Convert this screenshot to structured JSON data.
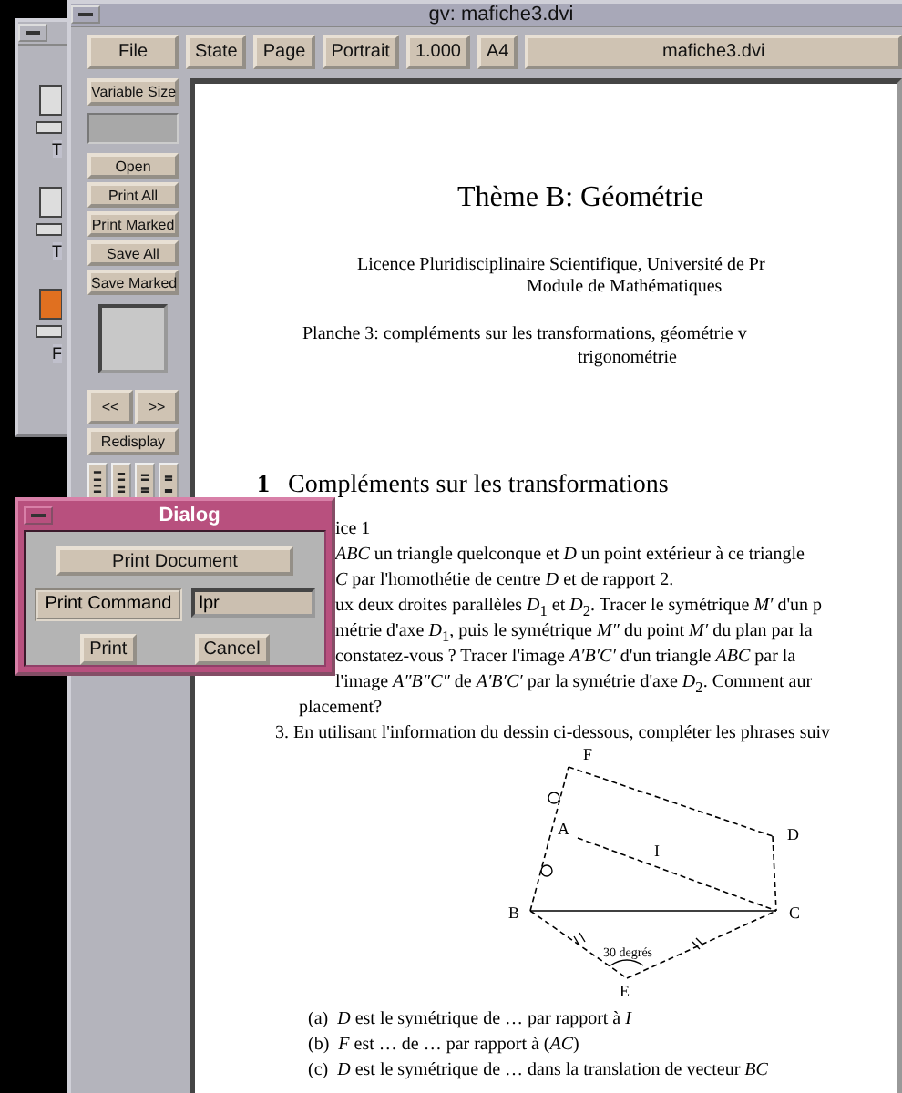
{
  "desktop_window": {
    "icon_labels": [
      "T",
      "T",
      "F"
    ]
  },
  "window": {
    "title": "gv: mafiche3.dvi"
  },
  "toolbar": {
    "buttons": [
      "File",
      "State",
      "Page",
      "Portrait",
      "1.000",
      "A4"
    ],
    "file_name": "mafiche3.dvi"
  },
  "sidebar": {
    "size_button": "Variable Size",
    "buttons": [
      "Open",
      "Print All",
      "Print Marked",
      "Save All",
      "Save Marked"
    ],
    "prev": "<<",
    "next": ">>",
    "redisplay": "Redisplay"
  },
  "document": {
    "lines": [
      {
        "kind": "title",
        "text": "Thème B: Géométrie"
      },
      {
        "kind": "text",
        "text": "Licence Pluridisciplinaire Scientifique, Université de Pr"
      },
      {
        "kind": "text",
        "text": "Module de Mathématiques"
      },
      {
        "kind": "text",
        "text": "Planche 3: compléments sur les transformations, géométrie v"
      },
      {
        "kind": "text",
        "text": "trigonométrie"
      },
      {
        "kind": "section",
        "number": "1",
        "text": "Compléments sur les transformations"
      },
      {
        "kind": "text",
        "text": "ice 1"
      },
      {
        "kind": "text",
        "text": "*ABC* un triangle quelconque et *D* un point extérieur à ce triangle"
      },
      {
        "kind": "text",
        "text": "*C* par l'homothétie de centre *D* et de rapport 2."
      },
      {
        "kind": "text",
        "text": "ux deux droites parallèles *D*$_{1}$ et *D*$_{2}$. Tracer le symétrique *M′* d'un p"
      },
      {
        "kind": "text",
        "text": "métrie d'axe *D*$_{1}$, puis le symétrique *M″* du point *M′* du plan par la"
      },
      {
        "kind": "text",
        "text": "constatez-vous ? Tracer l'image *A′B′C′* d'un triangle *ABC* par la"
      },
      {
        "kind": "text",
        "text": "l'image *A″B″C″* de *A′B′C′* par la symétrie d'axe *D*$_{2}$. Comment aur"
      },
      {
        "kind": "text",
        "text": "placement?"
      },
      {
        "kind": "text",
        "text": "3.  En utilisant l'information du dessin ci-dessous, compléter les phrases suiv"
      },
      {
        "kind": "figure",
        "labels": [
          "F",
          "A",
          "I",
          "D",
          "B",
          "C",
          "E"
        ],
        "angle": "30 degrés"
      },
      {
        "kind": "item",
        "number": "(a)",
        "text": "*D* est le symétrique de … par rapport à *I*"
      },
      {
        "kind": "item",
        "number": "(b)",
        "text": "*F* est … de … par rapport à (*AC*)"
      },
      {
        "kind": "item",
        "number": "(c)",
        "text": "*D* est le symétrique de … dans la translation de vecteur *BC*"
      }
    ]
  },
  "dialog": {
    "title": "Dialog",
    "action": "Print Document",
    "command_label": "Print Command",
    "command_value": "lpr",
    "buttons": [
      "Print",
      "Cancel"
    ]
  }
}
